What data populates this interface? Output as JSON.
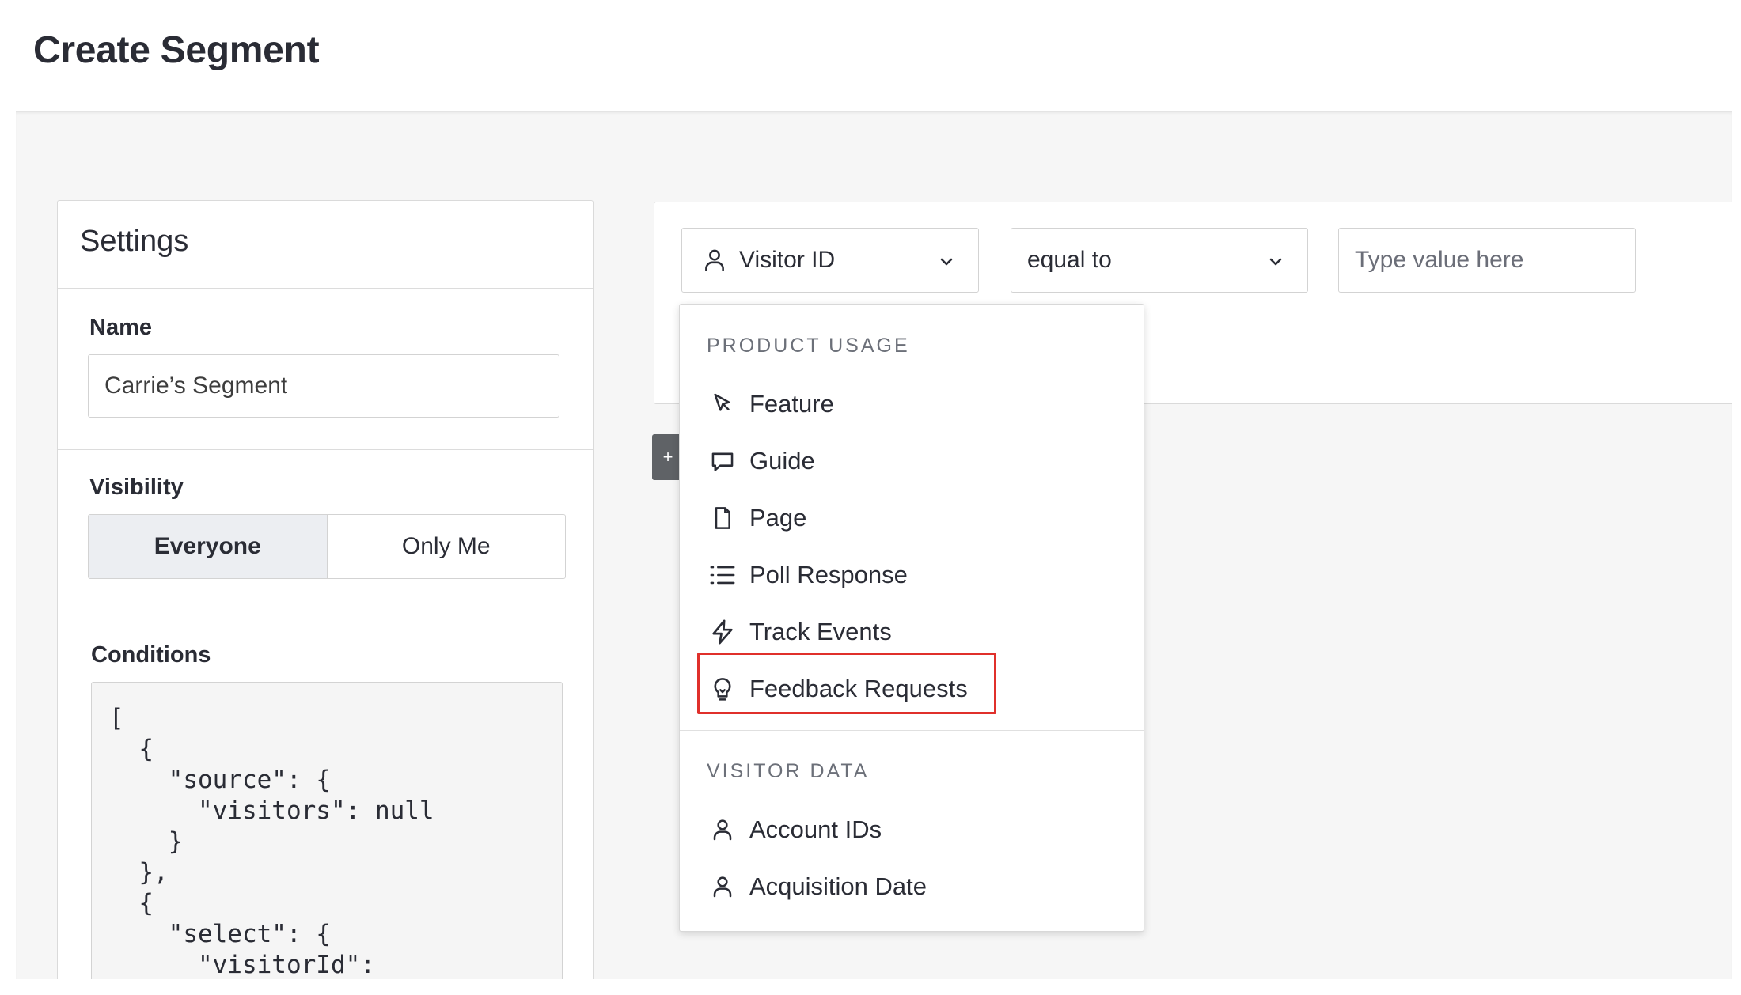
{
  "header": {
    "title": "Create Segment"
  },
  "settings": {
    "title": "Settings",
    "name_label": "Name",
    "name_value": "Carrie’s Segment",
    "visibility_label": "Visibility",
    "visibility_options": [
      "Everyone",
      "Only Me"
    ],
    "visibility_selected": "Everyone",
    "conditions_label": "Conditions",
    "conditions_code": "[\n  {\n    \"source\": {\n      \"visitors\": null\n    }\n  },\n  {\n    \"select\": {\n      \"visitorId\":"
  },
  "rule": {
    "field_select": {
      "value": "Visitor ID",
      "icon": "user-icon"
    },
    "operator_select": {
      "value": "equal to"
    },
    "value_input": {
      "placeholder": "Type value here",
      "value": ""
    },
    "add_button_label": "+"
  },
  "dropdown": {
    "sections": [
      {
        "heading": "Product Usage",
        "items": [
          {
            "label": "Feature",
            "icon": "cursor-icon"
          },
          {
            "label": "Guide",
            "icon": "chat-bubble-icon"
          },
          {
            "label": "Page",
            "icon": "document-icon"
          },
          {
            "label": "Poll Response",
            "icon": "list-icon"
          },
          {
            "label": "Track Events",
            "icon": "lightning-icon"
          },
          {
            "label": "Feedback Requests",
            "icon": "lightbulb-icon",
            "highlighted": true
          }
        ]
      },
      {
        "heading": "Visitor Data",
        "items": [
          {
            "label": "Account IDs",
            "icon": "user-icon"
          },
          {
            "label": "Acquisition Date",
            "icon": "user-icon"
          }
        ]
      }
    ]
  },
  "colors": {
    "highlight": "#e0302b",
    "background": "#f6f6f6",
    "active_toggle": "#eceef2",
    "add_button": "#5f6266"
  }
}
